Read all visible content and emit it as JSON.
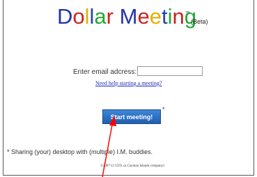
{
  "logo": {
    "letters": [
      {
        "ch": "D",
        "color": "#2233aa"
      },
      {
        "ch": "o",
        "color": "#cc2222"
      },
      {
        "ch": "l",
        "color": "#e0b000"
      },
      {
        "ch": "l",
        "color": "#2244bb"
      },
      {
        "ch": "a",
        "color": "#22aa33"
      },
      {
        "ch": "r",
        "color": "#cc2222"
      },
      {
        "ch": " ",
        "color": "#000000"
      },
      {
        "ch": "M",
        "color": "#2233aa"
      },
      {
        "ch": "e",
        "color": "#cc2222"
      },
      {
        "ch": "e",
        "color": "#e0b000"
      },
      {
        "ch": "t",
        "color": "#2244bb"
      },
      {
        "ch": "i",
        "color": "#22aa33"
      },
      {
        "ch": "n",
        "color": "#cc2222"
      },
      {
        "ch": "g",
        "color": "#22aa33"
      }
    ],
    "tm": "™",
    "beta": "(Beta)"
  },
  "form": {
    "email_label": "Enter email adcress:",
    "email_value": "",
    "help_link": "Need help starting a meeting?",
    "start_button": "Start meeting!",
    "asterisk": "*"
  },
  "footer": {
    "note": "* Sharing (your) desktop with (multiple) I.M. buddies.",
    "copyright": "©2007 Ur LTD. (a Cayman Islands company)"
  },
  "annotation": {
    "arrow_color": "#ff0000"
  }
}
